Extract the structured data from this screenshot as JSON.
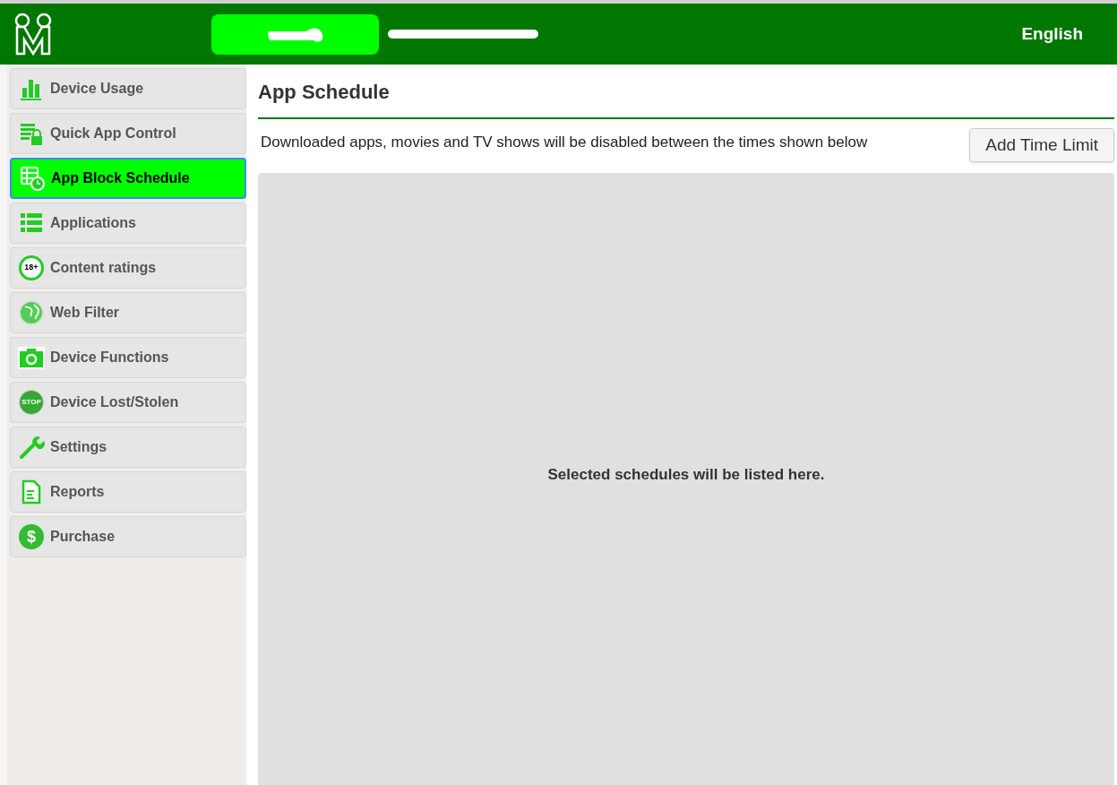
{
  "header": {
    "language": "English"
  },
  "sidebar": {
    "items": [
      {
        "label": "Device Usage",
        "kind": "bars",
        "selected": false
      },
      {
        "label": "Quick App Control",
        "kind": "lock",
        "selected": false
      },
      {
        "label": "App Block Schedule",
        "kind": "clock",
        "selected": true
      },
      {
        "label": "Applications",
        "kind": "list",
        "selected": false
      },
      {
        "label": "Content ratings",
        "kind": "age",
        "icon_text": "18+",
        "selected": false
      },
      {
        "label": "Web Filter",
        "kind": "globe",
        "selected": false
      },
      {
        "label": "Device Functions",
        "kind": "camera",
        "selected": false
      },
      {
        "label": "Device Lost/Stolen",
        "kind": "stop",
        "icon_text": "STOP",
        "selected": false
      },
      {
        "label": "Settings",
        "kind": "wrench",
        "selected": false
      },
      {
        "label": "Reports",
        "kind": "document",
        "selected": false
      },
      {
        "label": "Purchase",
        "kind": "dollar",
        "icon_text": "$",
        "selected": false
      }
    ]
  },
  "main": {
    "title": "App Schedule",
    "description": "Downloaded apps, movies and TV shows will be disabled between the times shown below",
    "add_button": "Add Time Limit",
    "empty_message": "Selected schedules will be listed here."
  }
}
